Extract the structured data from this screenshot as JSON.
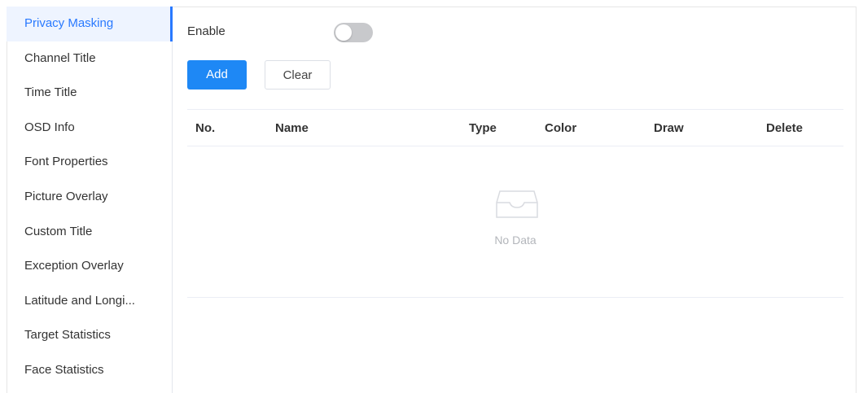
{
  "sidebar": {
    "items": [
      {
        "label": "Privacy Masking",
        "active": true
      },
      {
        "label": "Channel Title"
      },
      {
        "label": "Time Title"
      },
      {
        "label": "OSD Info"
      },
      {
        "label": "Font Properties"
      },
      {
        "label": "Picture Overlay"
      },
      {
        "label": "Custom Title"
      },
      {
        "label": "Exception Overlay"
      },
      {
        "label": "Latitude and Longi..."
      },
      {
        "label": "Target Statistics"
      },
      {
        "label": "Face Statistics"
      }
    ]
  },
  "main": {
    "enable_label": "Enable",
    "enable_on": false,
    "add_label": "Add",
    "clear_label": "Clear",
    "table": {
      "columns": [
        "No.",
        "Name",
        "Type",
        "Color",
        "Draw",
        "Delete"
      ],
      "rows": [],
      "empty_text": "No Data"
    }
  },
  "colors": {
    "accent": "#2979ff",
    "primary_button": "#1e88f5",
    "toggle_off": "#c8c9cc"
  }
}
